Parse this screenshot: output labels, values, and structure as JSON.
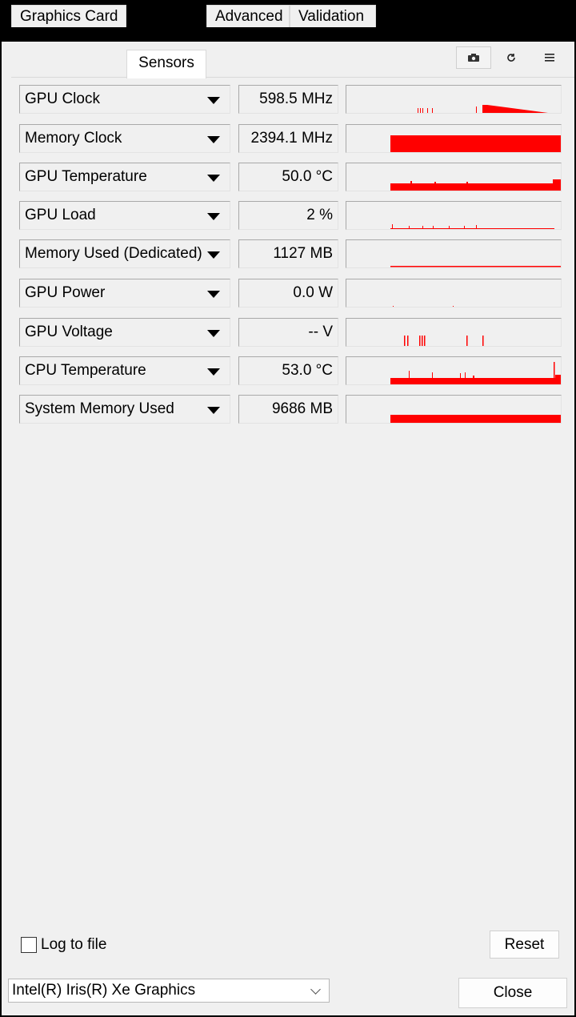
{
  "tabs": [
    {
      "label": "Graphics Card",
      "active": false
    },
    {
      "label": "Sensors",
      "active": true
    },
    {
      "label": "Advanced",
      "active": false
    },
    {
      "label": "Validation",
      "active": false
    }
  ],
  "toolbar": {
    "screenshot_icon": "camera-icon",
    "refresh_icon": "refresh-icon",
    "menu_icon": "hamburger-menu-icon"
  },
  "sensors": [
    {
      "name": "GPU Clock",
      "value": "598.5 MHz"
    },
    {
      "name": "Memory Clock",
      "value": "2394.1 MHz"
    },
    {
      "name": "GPU Temperature",
      "value": "50.0 °C"
    },
    {
      "name": "GPU Load",
      "value": "2 %"
    },
    {
      "name": "Memory Used (Dedicated)",
      "value": "1127 MB"
    },
    {
      "name": "GPU Power",
      "value": "0.0 W"
    },
    {
      "name": "GPU Voltage",
      "value": "-- V"
    },
    {
      "name": "CPU Temperature",
      "value": "53.0 °C"
    },
    {
      "name": "System Memory Used",
      "value": "9686 MB"
    }
  ],
  "graph_color": "#ff0000",
  "log_to_file": {
    "label": "Log to file",
    "checked": false
  },
  "reset_label": "Reset",
  "gpu_select": {
    "value": "Intel(R) Iris(R) Xe Graphics"
  },
  "close_label": "Close"
}
